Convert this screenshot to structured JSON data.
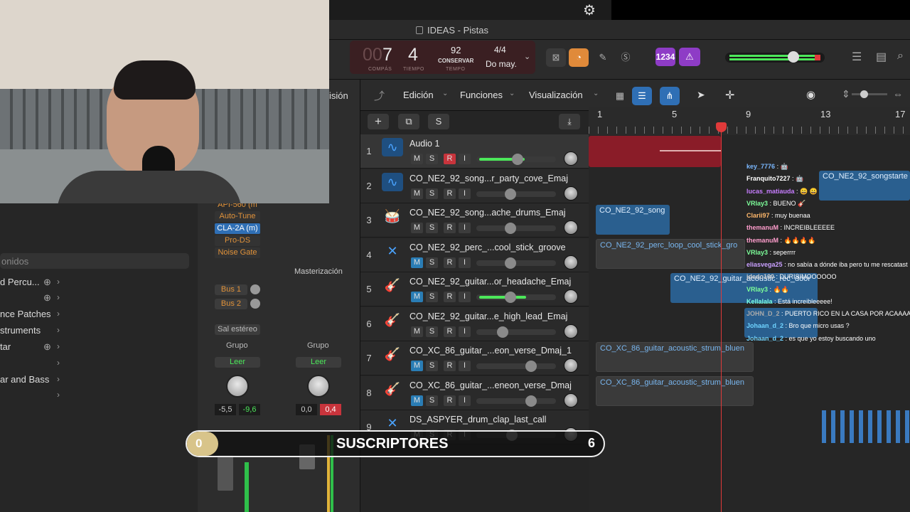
{
  "window": {
    "title": "IDEAS - Pistas"
  },
  "lcd": {
    "bar": "7",
    "beat": "4",
    "bar_dim": "00",
    "bar_label": "COMPÁS",
    "beat_label": "TIEMPO",
    "tempo": "92",
    "tempo_mode": "CONSERVAR",
    "tempo_label": "TEMPO",
    "signature": "4/4",
    "key": "Do may."
  },
  "controlbar": {
    "count_in": "1234"
  },
  "track_menu": {
    "edit": "Edición",
    "functions": "Funciones",
    "view": "Visualización"
  },
  "header_buttons": {
    "add": "+",
    "solo": "S"
  },
  "tracks": [
    {
      "num": "1",
      "name": "Audio 1",
      "icon": "waveform-icon",
      "m": "M",
      "s": "S",
      "r": "R",
      "i": "I"
    },
    {
      "num": "2",
      "name": "CO_NE2_92_song...r_party_cove_Emaj",
      "icon": "waveform-icon",
      "m": "M",
      "s": "S",
      "r": "R",
      "i": "I"
    },
    {
      "num": "3",
      "name": "CO_NE2_92_song...ache_drums_Emaj",
      "icon": "drums-icon",
      "m": "M",
      "s": "S",
      "r": "R",
      "i": "I"
    },
    {
      "num": "4",
      "name": "CO_NE2_92_perc_...cool_stick_groove",
      "icon": "sticks-icon",
      "m": "M",
      "s": "S",
      "r": "R",
      "i": "I"
    },
    {
      "num": "5",
      "name": "CO_NE2_92_guitar...or_headache_Emaj",
      "icon": "guitar-icon",
      "m": "M",
      "s": "S",
      "r": "R",
      "i": "I"
    },
    {
      "num": "6",
      "name": "CO_NE2_92_guitar...e_high_lead_Emaj",
      "icon": "guitar-icon",
      "m": "M",
      "s": "S",
      "r": "R",
      "i": "I"
    },
    {
      "num": "7",
      "name": "CO_XC_86_guitar_...eon_verse_Dmaj_1",
      "icon": "guitar-icon",
      "m": "M",
      "s": "S",
      "r": "R",
      "i": "I"
    },
    {
      "num": "8",
      "name": "CO_XC_86_guitar_...eneon_verse_Dmaj",
      "icon": "guitar-icon",
      "m": "M",
      "s": "S",
      "r": "R",
      "i": "I"
    },
    {
      "num": "9",
      "name": "DS_ASPYER_drum_clap_last_call",
      "icon": "sticks-icon",
      "m": "M",
      "s": "S",
      "r": "R",
      "i": "I"
    }
  ],
  "ruler": {
    "marks": [
      "1",
      "5",
      "9",
      "13",
      "17"
    ]
  },
  "regions": {
    "r2": "CO_NE2_92_songstarte",
    "r3": "CO_NE2_92_song",
    "r4": "CO_NE2_92_perc_loop_cool_stick_gro",
    "r5": "CO_NE2_92_guitar_acoustic_rec_door",
    "r7": "CO_XC_86_guitar_acoustic_strum_bluen",
    "r8": "CO_XC_86_guitar_acoustic_strum_bluen"
  },
  "browser": {
    "search_placeholder": "onidos",
    "items": [
      "d Percu...",
      "",
      "nce Patches",
      "struments",
      "tar",
      "",
      "ar and Bass",
      ""
    ]
  },
  "mixer": {
    "partial_label": "isión",
    "plugins": [
      "API-560 (m",
      "Auto-Tune",
      "CLA-2A (m)",
      "Pro-DS",
      "Noise Gate"
    ],
    "master_label": "Masterización",
    "bus1": "Bus 1",
    "bus2": "Bus 2",
    "output": "Sal estéreo",
    "group1": "Grupo",
    "group2": "Grupo",
    "read1": "Leer",
    "read2": "Leer",
    "vol1": "-5,5",
    "peak1": "-9,6",
    "vol2": "0,0",
    "peak2": "0,4"
  },
  "chat": [
    {
      "user": "key_7776",
      "msg": ": 🤖",
      "color": "#7ab8ff"
    },
    {
      "user": "Franquito7227",
      "msg": ": 🤖",
      "color": "#ffffff"
    },
    {
      "user": "lucas_matiauda",
      "msg": ": 😀 😀",
      "color": "#c77dff"
    },
    {
      "user": "VRlay3",
      "msg": ": BUENO 🎸",
      "color": "#7dff9a"
    },
    {
      "user": "Clarii97",
      "msg": ": muy buenaa",
      "color": "#ffb86b"
    },
    {
      "user": "themanuM",
      "msg": ": INCREIBLEEEEE",
      "color": "#ff9ecd"
    },
    {
      "user": "themanuM",
      "msg": ": 🔥🔥🔥🔥",
      "color": "#ff9ecd"
    },
    {
      "user": "VRlay3",
      "msg": ": seperrrr",
      "color": "#7dff9a"
    },
    {
      "user": "eliasvega25",
      "msg": ": no sabía a dónde iba pero tu me rescatast",
      "color": "#c9a0ff"
    },
    {
      "user": "jdedo100",
      "msg": ": DURISIMOOOOOO",
      "color": "#cccccc"
    },
    {
      "user": "VRlay3",
      "msg": ": 🔥🔥",
      "color": "#7dff9a"
    },
    {
      "user": "Kellalala",
      "msg": ": Está increibleeeee!",
      "color": "#7affe0"
    },
    {
      "user": "JOHN_D_2",
      "msg": ": PUERTO RICO EN LA CASA POR ACAAAA",
      "color": "#aaaaaa"
    },
    {
      "user": "Johaan_d_2",
      "msg": ": Bro que micro usas ?",
      "color": "#6fd3ff"
    },
    {
      "user": "Johaan_d_2",
      "msg": ": es que yo estoy buscando uno",
      "color": "#6fd3ff"
    }
  ],
  "subscribers": {
    "left": "0",
    "label": "SUSCRIPTORES",
    "right": "6"
  },
  "colors": {
    "accent_blue": "#4aa3ff",
    "record_red": "#c8343c",
    "orange": "#e08a3a",
    "purple": "#8e3cc6"
  }
}
